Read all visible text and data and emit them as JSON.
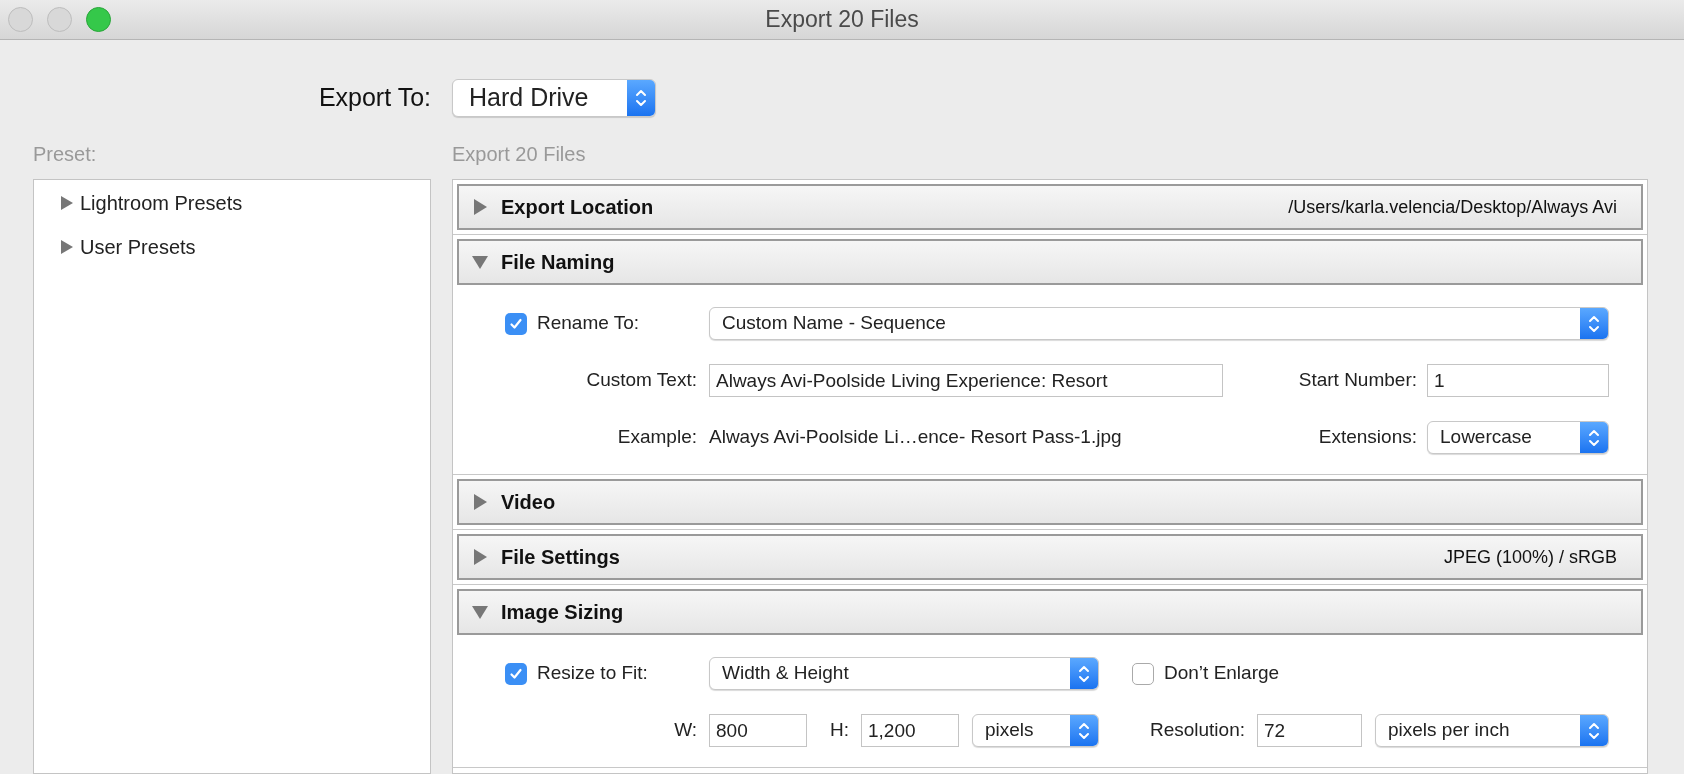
{
  "window": {
    "title": "Export 20 Files"
  },
  "export_to": {
    "label": "Export To:",
    "value": "Hard Drive"
  },
  "presets": {
    "label": "Preset:",
    "items": [
      {
        "label": "Lightroom Presets",
        "expanded": false
      },
      {
        "label": "User Presets",
        "expanded": false
      }
    ]
  },
  "panel": {
    "title": "Export 20 Files",
    "sections": [
      {
        "kind": "plain",
        "title": "Export Location",
        "expanded": false,
        "summary": "/Users/karla.velencia/Desktop/Always Avi"
      },
      {
        "kind": "file_naming",
        "title": "File Naming",
        "expanded": true,
        "rename": {
          "checked": true,
          "label": "Rename To:",
          "value": "Custom Name - Sequence"
        },
        "custom_text": {
          "label": "Custom Text:",
          "value": "Always Avi-Poolside Living Experience: Resort"
        },
        "start_number": {
          "label": "Start Number:",
          "value": "1"
        },
        "example": {
          "label": "Example:",
          "value": "Always Avi-Poolside Li…ence- Resort Pass-1.jpg"
        },
        "extensions": {
          "label": "Extensions:",
          "value": "Lowercase"
        }
      },
      {
        "kind": "plain",
        "title": "Video",
        "expanded": false
      },
      {
        "kind": "plain",
        "title": "File Settings",
        "expanded": false,
        "summary": "JPEG (100%) / sRGB"
      },
      {
        "kind": "image_sizing",
        "title": "Image Sizing",
        "expanded": true,
        "resize": {
          "checked": true,
          "label": "Resize to Fit:",
          "value": "Width & Height"
        },
        "dont_enlarge": {
          "checked": false,
          "label": "Don’t Enlarge"
        },
        "width": {
          "label": "W:",
          "value": "800"
        },
        "height": {
          "label": "H:",
          "value": "1,200"
        },
        "units": {
          "value": "pixels"
        },
        "resolution": {
          "label": "Resolution:",
          "value": "72"
        },
        "resolution_units": {
          "value": "pixels per inch"
        }
      }
    ]
  }
}
